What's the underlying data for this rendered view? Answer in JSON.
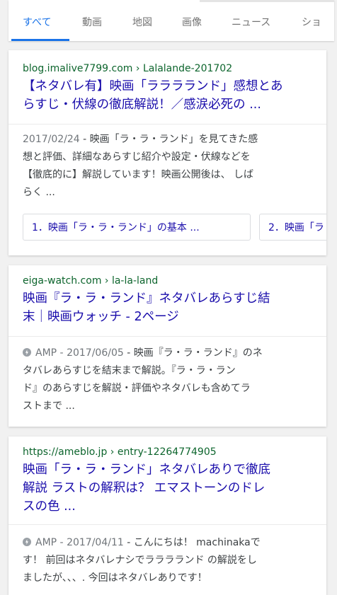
{
  "tabs": [
    {
      "label": "すべて"
    },
    {
      "label": "動画"
    },
    {
      "label": "地図"
    },
    {
      "label": "画像"
    },
    {
      "label": "ニュース"
    },
    {
      "label": "ショ"
    }
  ],
  "results": [
    {
      "url": "blog.imalive7799.com › Lalalande-201702",
      "title_lines": [
        "【ネタバレ有】映画「ラララランド」感想とあ",
        "らすじ・伏線の徹底解説！／感涙必死の ..."
      ],
      "date": "2017/02/24",
      "snippet_lines": [
        " - 映画「ラ・ラ・ランド」を見てきた感",
        "想と評価、詳細なあらすじ紹介や設定・伏線などを",
        "【徹底的に】解説しています！映画公開後は、 しば",
        "らく ..."
      ],
      "chips": [
        "1．映画「ラ・ラ・ランド」の基本 ...",
        "2．映画「ラ"
      ]
    },
    {
      "url": "eiga-watch.com › la-la-land",
      "title_lines": [
        "映画『ラ・ラ・ランド』ネタバレあらすじ結",
        "末｜映画ウォッチ - 2ページ"
      ],
      "amp": "AMP",
      "date": "2017/06/05",
      "snippet_lines": [
        " - 映画『ラ・ラ・ランド』のネ",
        "タバレあらすじを結末まで解説。『ラ・ラ・ラン",
        "ド』のあらすじを解説・評価やネタバレも含めてラ",
        "ストまで ..."
      ]
    },
    {
      "url": "https://ameblo.jp › entry-12264774905",
      "title_lines": [
        "映画「ラ・ラ・ランド」ネタバレありで徹底",
        "解説 ラストの解釈は？ エマストーンのドレ",
        "スの色 ..."
      ],
      "amp": "AMP",
      "date": "2017/04/11",
      "snippet_lines": [
        " - こんにちは！ machinakaで",
        "す！ 前回はネタバレナシでラララランド の解説をし",
        "ましたが、、、. 今回はネタバレありです！"
      ]
    }
  ],
  "colors": {
    "accent": "#1a73e8",
    "link": "#1a0dab",
    "url": "#0d652d"
  },
  "icons": {
    "amp": "amp-bolt-icon"
  }
}
